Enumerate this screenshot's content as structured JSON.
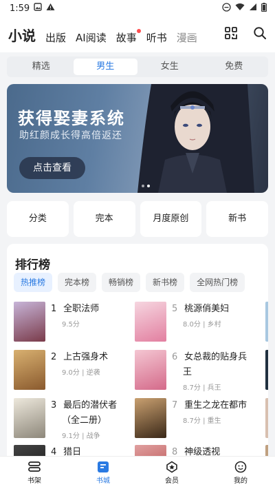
{
  "status": {
    "time": "1:59"
  },
  "top_tabs": [
    {
      "label": "小说",
      "active": true
    },
    {
      "label": "出版"
    },
    {
      "label": "AI阅读"
    },
    {
      "label": "故事",
      "dot": true
    },
    {
      "label": "听书"
    },
    {
      "label": "漫画"
    }
  ],
  "segments": [
    {
      "label": "精选"
    },
    {
      "label": "男生",
      "active": true
    },
    {
      "label": "女生"
    },
    {
      "label": "免费"
    }
  ],
  "banner": {
    "title": "获得娶妻系统",
    "subtitle": "助红颜成长得高倍返还",
    "button": "点击查看"
  },
  "categories": [
    "分类",
    "完本",
    "月度原创",
    "新书"
  ],
  "ranking": {
    "title": "排行榜",
    "chips": [
      {
        "label": "热推榜",
        "active": true
      },
      {
        "label": "完本榜"
      },
      {
        "label": "畅销榜"
      },
      {
        "label": "新书榜"
      },
      {
        "label": "全网热门榜"
      }
    ],
    "left_books": [
      {
        "rank": "1",
        "name": "全职法师",
        "meta": "9.5分",
        "cover": "#7a3b4a"
      },
      {
        "rank": "2",
        "name": "上古强身术",
        "meta": "9.0分 | 逆袭",
        "cover": "#8a5a2e"
      },
      {
        "rank": "3",
        "name": "最后的潜伏者",
        "name2": "（全二册）",
        "meta": "9.1分 | 战争",
        "cover": "#c9c4b8"
      },
      {
        "rank": "4",
        "name": "猎日",
        "meta": "",
        "cover": "#1c1c1c"
      }
    ],
    "right_books": [
      {
        "rank": "5",
        "name": "桃源俏美妇",
        "meta": "8.0分 | 乡村",
        "cover": "#e27fa0"
      },
      {
        "rank": "6",
        "name": "女总裁的贴身兵",
        "name2": "王",
        "meta": "8.7分 | 兵王",
        "cover": "#d46a8a"
      },
      {
        "rank": "7",
        "name": "重生之龙在都市",
        "meta": "8.7分 | 重生",
        "cover": "#6a4a30"
      },
      {
        "rank": "8",
        "name": "神级透视",
        "meta": "",
        "cover": "#b04040"
      }
    ]
  },
  "bottom_nav": [
    {
      "label": "书架",
      "icon": "bookshelf-icon"
    },
    {
      "label": "书城",
      "icon": "bookstore-icon",
      "active": true
    },
    {
      "label": "会员",
      "icon": "member-icon"
    },
    {
      "label": "我的",
      "icon": "profile-icon"
    }
  ]
}
